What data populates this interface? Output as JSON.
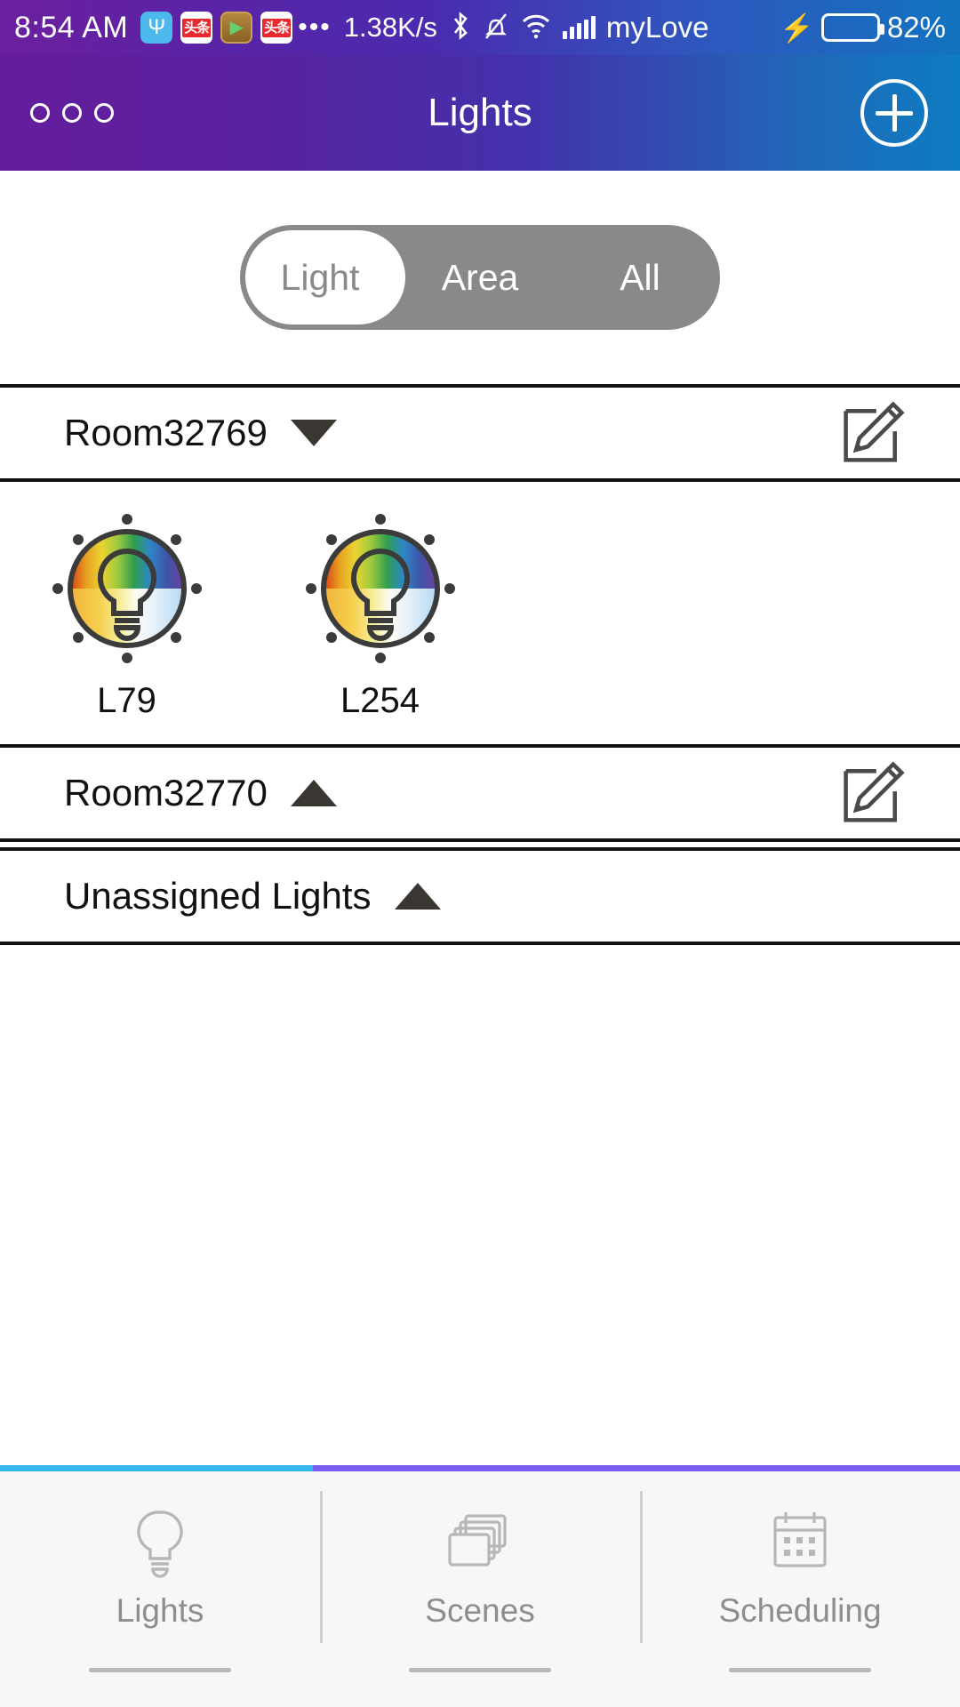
{
  "status_bar": {
    "time": "8:54 AM",
    "app_icons": [
      {
        "name": "usb-icon",
        "glyph": "Ψ"
      },
      {
        "name": "toutiao-news-icon",
        "glyph": "头条"
      },
      {
        "name": "video-player-icon",
        "glyph": "▶"
      },
      {
        "name": "toutiao-news-icon-2",
        "glyph": "头条"
      }
    ],
    "overflow_dots": "•••",
    "network_speed": "1.38K/s",
    "bluetooth_icon": "ᛦ",
    "silent_icon": "⌀",
    "wifi_icon": "◔",
    "signal_icon": "signal-bars",
    "carrier": "myLove",
    "charging_icon": "⚡",
    "battery_percent": "82%",
    "battery_level": 82,
    "battery_color": "#3ddc28"
  },
  "header": {
    "menu_label": "menu",
    "title": "Lights",
    "add_label": "+",
    "gradient_start": "#641d9b",
    "gradient_end": "#0d7cc2"
  },
  "segmented_control": {
    "options": [
      "Light",
      "Area",
      "All"
    ],
    "selected_index": 0,
    "track_color": "#898989",
    "thumb_color": "#ffffff",
    "active_text_color": "#8a8a8a",
    "inactive_text_color": "#ffffff"
  },
  "groups": [
    {
      "name": "Room32769",
      "expanded": true,
      "arrow": "down",
      "edit_icon": "edit-pencil-icon",
      "lights": [
        {
          "label": "L79"
        },
        {
          "label": "L254"
        }
      ]
    },
    {
      "name": "Room32770",
      "expanded": false,
      "arrow": "up",
      "edit_icon": "edit-pencil-icon",
      "lights": []
    },
    {
      "name": "Unassigned Lights",
      "expanded": false,
      "arrow": "up",
      "edit_icon": null,
      "lights": []
    }
  ],
  "bottom_nav": {
    "accent_left_color": "#35b7ef",
    "accent_right_color": "#7a5cf0",
    "tabs": [
      {
        "label": "Lights",
        "icon": "lightbulb-icon",
        "selected": true
      },
      {
        "label": "Scenes",
        "icon": "stacked-cards-icon",
        "selected": false
      },
      {
        "label": "Scheduling",
        "icon": "calendar-icon",
        "selected": false
      }
    ],
    "label_color": "#8e8e8e"
  }
}
